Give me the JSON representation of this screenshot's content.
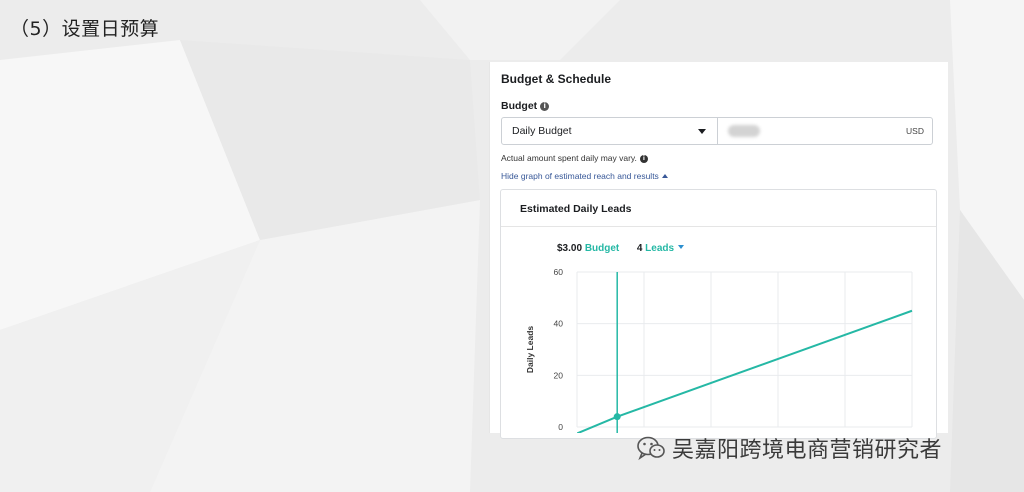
{
  "slide": {
    "title": "（5）设置日预算",
    "watermark": "吴嘉阳跨境电商营销研究者"
  },
  "panel": {
    "heading": "Budget & Schedule",
    "budget_label": "Budget",
    "budget_type": "Daily Budget",
    "amount_value": "",
    "currency": "USD",
    "note": "Actual amount spent daily may vary.",
    "toggle_link": "Hide graph of estimated reach and results"
  },
  "chart_card": {
    "title": "Estimated Daily Leads",
    "budget_amount": "$3.00",
    "budget_word": "Budget",
    "leads_count": "4",
    "leads_word": "Leads"
  },
  "colors": {
    "accent": "#25b8a5",
    "link": "#385898"
  },
  "chart_data": {
    "type": "line",
    "title": "Estimated Daily Leads",
    "xlabel": "",
    "ylabel": "Daily Leads",
    "y_ticks": [
      0,
      20,
      40,
      60
    ],
    "ylim": [
      0,
      60
    ],
    "xlim": [
      0,
      25
    ],
    "grid": true,
    "series": [
      {
        "x": [
          0,
          3,
          25
        ],
        "y": [
          -2.5,
          4,
          45
        ]
      }
    ],
    "marker": {
      "x": 3,
      "y": 4,
      "label": "$3.00 Budget"
    }
  }
}
